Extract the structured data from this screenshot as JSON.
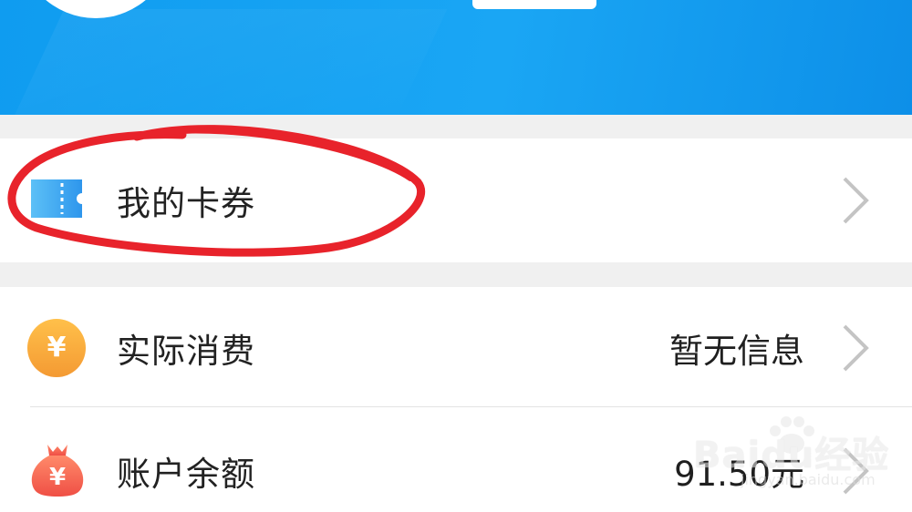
{
  "rows": {
    "cards": {
      "label": "我的卡券",
      "icon": "ticket-icon"
    },
    "actual_spend": {
      "label": "实际消费",
      "value": "暂无信息",
      "icon": "yen-coin-icon",
      "icon_symbol": "¥"
    },
    "balance": {
      "label": "账户余额",
      "value": "91.50元",
      "icon": "money-bag-icon",
      "icon_symbol": "¥"
    }
  },
  "watermark": {
    "brand": "Baidu经验",
    "site": "jingyan.baidu.com"
  },
  "colors": {
    "header_blue": "#1aa6f4",
    "annotation_red": "#e8232b",
    "coin_orange": "#f7a838",
    "bag_red": "#f25b4f",
    "ticket_blue": "#3aa8f2"
  }
}
